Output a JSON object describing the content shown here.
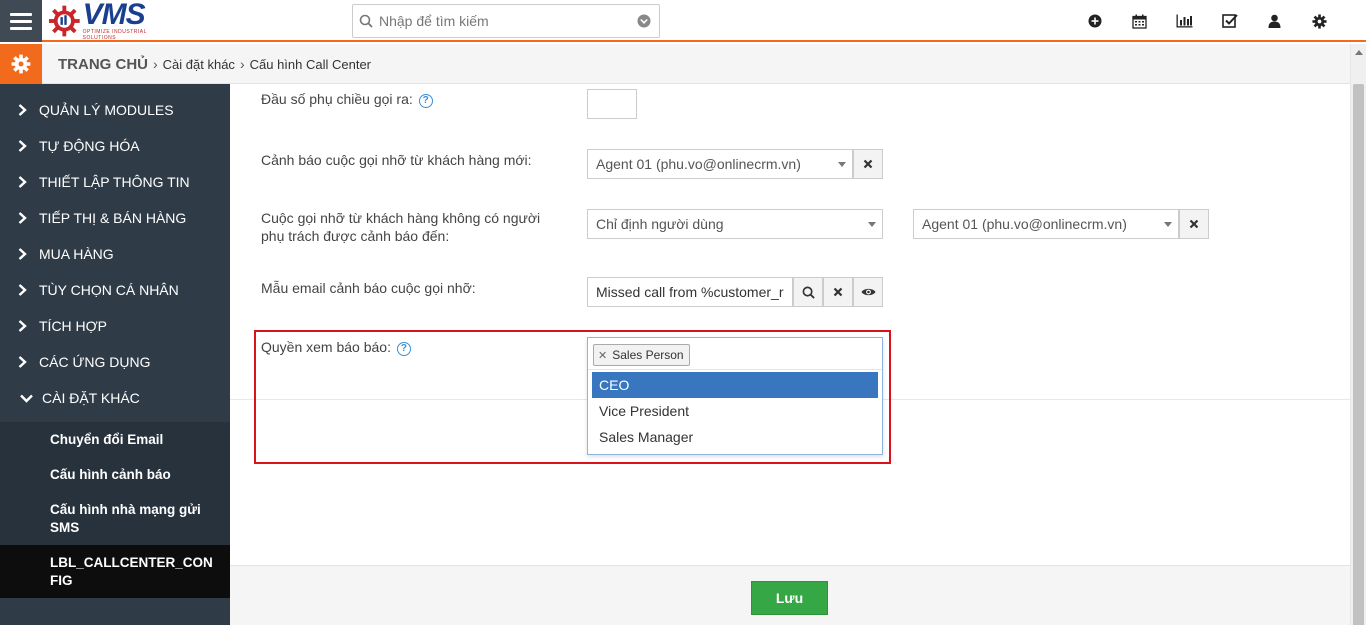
{
  "header": {
    "logo_text": "VMS",
    "logo_subtext": "OPTIMIZE INDUSTRIAL SOLUTIONS",
    "search_placeholder": "Nhập để tìm kiếm",
    "icons": [
      "plus-circle-icon",
      "calendar-icon",
      "bar-chart-icon",
      "check-square-icon",
      "user-icon",
      "gear-icon"
    ],
    "accent_color": "#f26b1d"
  },
  "breadcrumb": {
    "home": "TRANG CHỦ",
    "level1": "Cài đặt khác",
    "level2": "Cấu hình Call Center",
    "separator": "›"
  },
  "sidebar": {
    "items": [
      {
        "label": "QUẢN LÝ MODULES"
      },
      {
        "label": "TỰ ĐỘNG HÓA"
      },
      {
        "label": "THIẾT LẬP THÔNG TIN"
      },
      {
        "label": "TIẾP THỊ & BÁN HÀNG"
      },
      {
        "label": "MUA HÀNG"
      },
      {
        "label": "TÙY CHỌN CÁ NHÂN"
      },
      {
        "label": "TÍCH HỢP"
      },
      {
        "label": "CÁC ỨNG DỤNG"
      },
      {
        "label": "CÀI ĐẶT KHÁC"
      }
    ],
    "subitems": [
      {
        "label": "Chuyển đổi Email"
      },
      {
        "label": "Cấu hình cảnh báo"
      },
      {
        "label": "Cấu hình nhà mạng gửi SMS"
      },
      {
        "label": "LBL_CALLCENTER_CONFIG"
      }
    ]
  },
  "form": {
    "outbound_prefix": {
      "label": "Đầu số phụ chiều gọi ra:",
      "value": ""
    },
    "missed_new_customer": {
      "label": "Cảnh báo cuộc gọi nhỡ từ khách hàng mới:",
      "value": "Agent 01 (phu.vo@onlinecrm.vn)"
    },
    "missed_no_owner": {
      "label": "Cuộc gọi nhỡ từ khách hàng không có người phụ trách được cảnh báo đến:",
      "mode_value": "Chỉ định người dùng",
      "user_value": "Agent 01 (phu.vo@onlinecrm.vn)"
    },
    "missed_email_template": {
      "label": "Mẫu email cảnh báo cuộc gọi nhỡ:",
      "value": "Missed call from %customer_r"
    },
    "report_permission": {
      "label": "Quyền xem báo báo:",
      "selected_tags": [
        "Sales Person"
      ],
      "options": [
        {
          "label": "CEO",
          "highlighted": true
        },
        {
          "label": "Vice President",
          "highlighted": false
        },
        {
          "label": "Sales Manager",
          "highlighted": false
        }
      ]
    }
  },
  "footer": {
    "save_label": "Lưu"
  }
}
